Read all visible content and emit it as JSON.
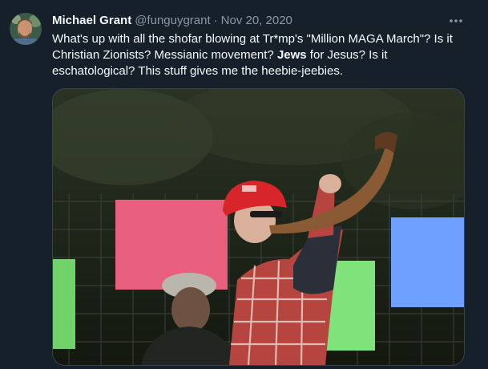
{
  "tweet": {
    "author_name": "Michael Grant",
    "author_handle": "@funguygrant",
    "separator": "·",
    "date": "Nov 20, 2020",
    "more_icon": "more-horizontal-icon",
    "text_part1": "What's up with all the shofar blowing at Tr*mp's \"Million MAGA March\"? Is it Christian Zionists? Messianic movement? ",
    "text_bold": "Jews",
    "text_part2": " for Jesus? Is it eschatological? This stuff gives me the heebie-jeebies."
  },
  "colors": {
    "background": "#15202b",
    "primary_text": "#f7f9f9",
    "secondary_text": "#8b98a5",
    "border": "#38444d"
  }
}
